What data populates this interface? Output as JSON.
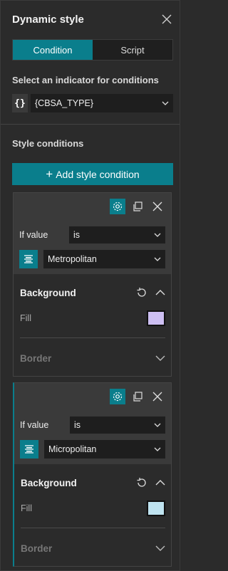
{
  "header": {
    "title": "Dynamic style"
  },
  "tabs": [
    {
      "label": "Condition",
      "active": true
    },
    {
      "label": "Script",
      "active": false
    }
  ],
  "indicator": {
    "label": "Select an indicator for conditions",
    "icon_text": "{}",
    "value": "{CBSA_TYPE}"
  },
  "style_conditions": {
    "label": "Style conditions",
    "add_button": "Add style condition",
    "conditions": [
      {
        "if_label": "If value",
        "operator": "is",
        "value": "Metropolitan",
        "background_label": "Background",
        "fill_label": "Fill",
        "fill_color": "#cdbff2",
        "border_label": "Border"
      },
      {
        "if_label": "If value",
        "operator": "is",
        "value": "Micropolitan",
        "background_label": "Background",
        "fill_label": "Fill",
        "fill_color": "#bfe3f0",
        "border_label": "Border"
      }
    ]
  },
  "colors": {
    "accent": "#0a7e8c",
    "panel": "#2b2b2b",
    "card_top": "#3a3a3a"
  }
}
